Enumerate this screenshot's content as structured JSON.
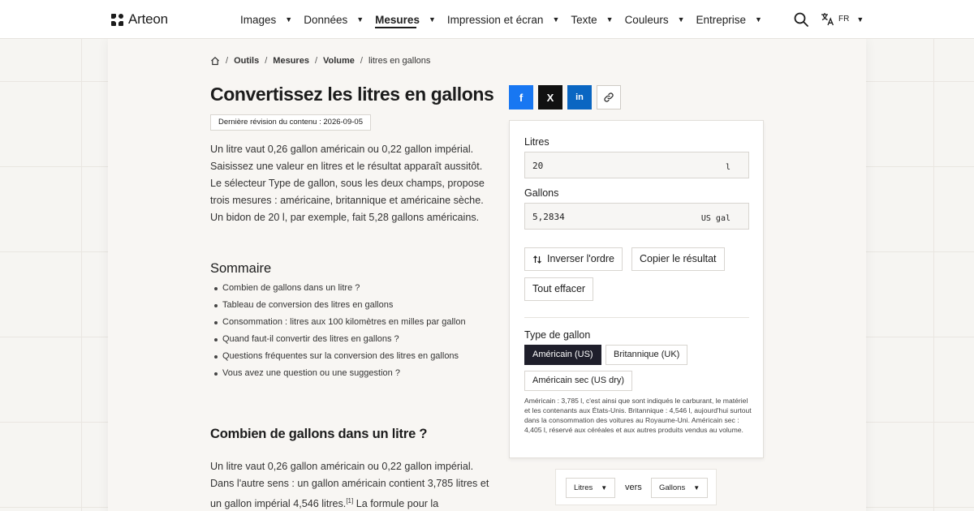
{
  "brand": {
    "name": "Arteon"
  },
  "nav": {
    "items": [
      {
        "label": "Images"
      },
      {
        "label": "Données"
      },
      {
        "label": "Mesures"
      },
      {
        "label": "Impression et écran"
      },
      {
        "label": "Texte"
      },
      {
        "label": "Couleurs"
      },
      {
        "label": "Entreprise"
      }
    ],
    "active_index": 2,
    "language": "FR",
    "caret": "▼"
  },
  "breadcrumb": {
    "items": [
      "Outils",
      "Mesures",
      "Volume"
    ],
    "current": "litres en gallons",
    "separator": "/"
  },
  "page": {
    "title": "Convertissez les litres en gallons",
    "revision": "Dernière révision du contenu : 2026-09-05",
    "intro": "Un litre vaut 0,26 gallon américain ou 0,22 gallon impérial. Saisissez une valeur en litres et le résultat apparaît aussitôt. Le sélecteur Type de gallon, sous les deux champs, propose trois mesures : américaine, britannique et américaine sèche. Un bidon de 20 l, par exemple, fait 5,28 gallons américains.",
    "summary_title": "Sommaire",
    "summary_items": [
      "Combien de gallons dans un litre ?",
      "Tableau de conversion des litres en gallons",
      "Consommation : litres aux 100 kilomètres en milles par gallon",
      "Quand faut-il convertir des litres en gallons ?",
      "Questions fréquentes sur la conversion des litres en gallons",
      "Vous avez une question ou une suggestion ?"
    ],
    "section_title": "Combien de gallons dans un litre ?",
    "section_text_before": "Un litre vaut 0,26 gallon américain ou 0,22 gallon impérial. Dans l'autre sens : un gallon américain contient 3,785 litres et un gallon impérial 4,546 litres.",
    "section_footnote": "[1]",
    "section_text_after": " La formule pour la"
  },
  "share": {
    "facebook": "f",
    "x": "X",
    "linkedin": "in"
  },
  "converter": {
    "litres_label": "Litres",
    "litres_value": "20",
    "litres_unit": "l",
    "gallons_label": "Gallons",
    "gallons_value": "5,2834",
    "gallons_unit": "US gal",
    "swap_label": "Inverser l'ordre",
    "copy_label": "Copier le résultat",
    "clear_label": "Tout effacer",
    "type_label": "Type de gallon",
    "types": [
      "Américain (US)",
      "Britannique (UK)",
      "Américain sec (US dry)"
    ],
    "selected_type_index": 0,
    "note": "Américain : 3,785 l, c'est ainsi que sont indiqués le carburant, le matériel et les contenants aux États-Unis. Britannique : 4,546 l, aujourd'hui surtout dans la consommation des voitures au Royaume-Uni. Américain sec : 4,405 l, réservé aux céréales et aux autres produits vendus au volume."
  },
  "units_bar": {
    "from": "Litres",
    "to": "Gallons",
    "vers": "vers",
    "caret": "▼"
  },
  "colors": {
    "accent_dark": "#1f1f2b",
    "facebook": "#1877f2",
    "linkedin": "#0a66c2",
    "x": "#111111"
  }
}
